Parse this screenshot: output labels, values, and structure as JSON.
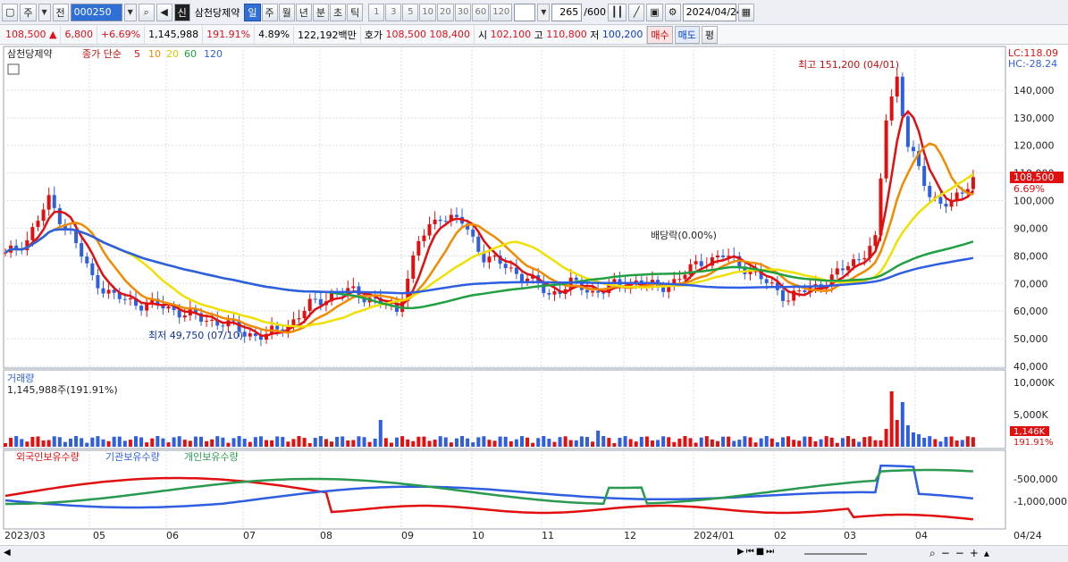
{
  "toolbar": {
    "market_label": "주",
    "prev_label": "전",
    "code": "000250",
    "credit_badge": "신",
    "stock_name": "삼천당제약",
    "period_tabs": [
      "일",
      "주",
      "월",
      "년",
      "분",
      "초",
      "틱"
    ],
    "active_period": "일",
    "intervals": [
      "1",
      "3",
      "5",
      "10",
      "20",
      "30",
      "60",
      "120"
    ],
    "count": "265",
    "count_max": "/600",
    "date": "2024/04/24"
  },
  "quote": {
    "price": "108,500",
    "change": "6,800",
    "change_pct": "+6.69%",
    "volume": "1,145,988",
    "volume_ratio": "191.91%",
    "turnover": "4.89%",
    "amount": "122,192백만",
    "bid_label": "호가",
    "ask": "108,500",
    "bid": "108,400",
    "open_label": "시",
    "open": "102,100",
    "high_label": "고",
    "high": "110,800",
    "low_label": "저",
    "low": "100,200",
    "buy_label": "매수",
    "sell_label": "매도",
    "eval_label": "평"
  },
  "price_panel": {
    "stock_name": "삼천당제약",
    "ma_label": "종가 단순",
    "ma_periods": [
      "5",
      "10",
      "20",
      "60",
      "120"
    ],
    "ma_colors": [
      "#e01010",
      "#f08a00",
      "#f0e000",
      "#20a040",
      "#2f5fe0"
    ],
    "lc": "LC:118.09",
    "hc": "HC:-28.24",
    "high_note": "최고 151,200 (04/01)",
    "low_note": "최저 49,750 (07/10)",
    "dividend_note": "배당락(0.00%)",
    "current_price": "108,500",
    "current_pct": "6.69%",
    "y_ticks": [
      "140,000",
      "130,000",
      "120,000",
      "110,000",
      "100,000",
      "90,000",
      "80,000",
      "70,000",
      "60,000",
      "50,000",
      "40,000"
    ]
  },
  "volume_panel": {
    "title": "거래량",
    "value": "1,145,988주(191.91%)",
    "y_ticks": [
      "10,000K",
      "5,000K"
    ],
    "current": "1,146K",
    "current_pct": "191.91%"
  },
  "holding_panel": {
    "series": [
      "외국인보유수량",
      "기관보유수량",
      "개인보유수량"
    ],
    "series_colors": [
      "#e01010",
      "#2f5fe0",
      "#2a9a50"
    ],
    "y_ticks": [
      "-500,000",
      "-1,000,000"
    ]
  },
  "x_axis": {
    "labels": [
      "2023/03",
      "05",
      "06",
      "07",
      "08",
      "09",
      "10",
      "11",
      "12",
      "2024/01",
      "02",
      "03",
      "04"
    ],
    "last": "04/24"
  },
  "chart_data": {
    "type": "candlestick",
    "series": [
      {
        "name": "종가",
        "points": [
          [
            0,
            80000
          ],
          [
            4,
            86000
          ],
          [
            8,
            100000
          ],
          [
            12,
            88000
          ],
          [
            16,
            72000
          ],
          [
            20,
            65000
          ],
          [
            24,
            63000
          ],
          [
            28,
            62000
          ],
          [
            32,
            60000
          ],
          [
            36,
            57000
          ],
          [
            40,
            56000
          ],
          [
            44,
            52000
          ],
          [
            48,
            51000
          ],
          [
            52,
            55000
          ],
          [
            56,
            62000
          ],
          [
            60,
            66000
          ],
          [
            64,
            67000
          ],
          [
            68,
            64000
          ],
          [
            72,
            60000
          ],
          [
            76,
            85000
          ],
          [
            80,
            95000
          ],
          [
            84,
            92000
          ],
          [
            88,
            80000
          ],
          [
            92,
            76000
          ],
          [
            96,
            72000
          ],
          [
            100,
            66000
          ],
          [
            104,
            70000
          ],
          [
            108,
            67000
          ],
          [
            112,
            69000
          ],
          [
            116,
            71000
          ],
          [
            120,
            68000
          ],
          [
            124,
            72000
          ],
          [
            128,
            78000
          ],
          [
            132,
            80000
          ],
          [
            136,
            76000
          ],
          [
            140,
            70000
          ],
          [
            144,
            65000
          ],
          [
            148,
            68000
          ],
          [
            152,
            72000
          ],
          [
            156,
            78000
          ],
          [
            160,
            85000
          ],
          [
            162,
            130000
          ],
          [
            164,
            145000
          ],
          [
            166,
            120000
          ],
          [
            170,
            102000
          ],
          [
            174,
            98000
          ],
          [
            178,
            108500
          ]
        ]
      }
    ],
    "ylim": [
      40000,
      150000
    ]
  }
}
